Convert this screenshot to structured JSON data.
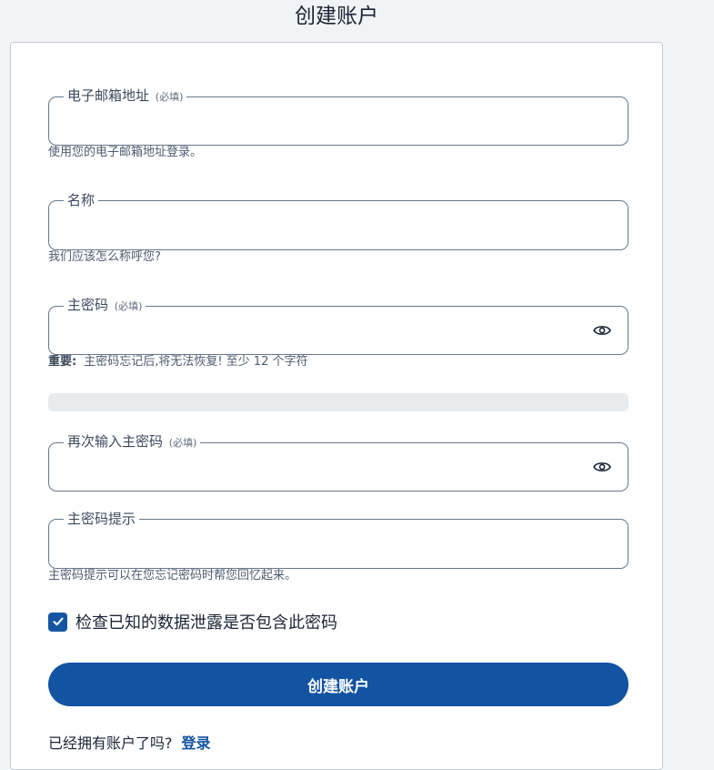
{
  "page": {
    "title": "创建账户"
  },
  "form": {
    "email": {
      "label": "电子邮箱地址",
      "required": "(必填)",
      "value": "",
      "hint": "使用您的电子邮箱地址登录。"
    },
    "name": {
      "label": "名称",
      "value": "",
      "hint": "我们应该怎么称呼您?"
    },
    "master_password": {
      "label": "主密码",
      "required": "(必填)",
      "value": "",
      "hint_bold": "重要:",
      "hint": "主密码忘记后,将无法恢复! 至少 12 个字符",
      "toggle_icon": "eye-icon"
    },
    "strength_meter": {
      "level": 0
    },
    "confirm_password": {
      "label": "再次输入主密码",
      "required": "(必填)",
      "value": "",
      "toggle_icon": "eye-icon"
    },
    "password_hint": {
      "label": "主密码提示",
      "value": "",
      "hint": "主密码提示可以在您忘记密码时帮您回忆起来。"
    },
    "breach_check": {
      "label": "检查已知的数据泄露是否包含此密码",
      "checked": true
    },
    "submit_label": "创建账户",
    "footer": {
      "text": "已经拥有账户了吗?",
      "login_link": "登录"
    }
  },
  "colors": {
    "primary": "#1253a2",
    "background": "#f1f4f7",
    "border": "#68778c"
  }
}
